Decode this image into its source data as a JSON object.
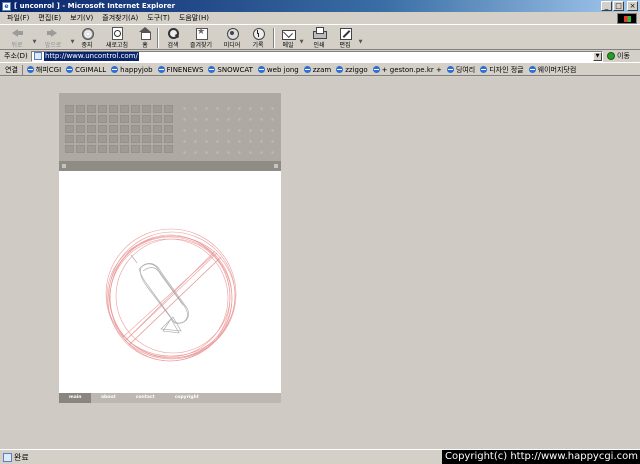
{
  "window": {
    "title": "[ unconrol ] - Microsoft Internet Explorer"
  },
  "menu": [
    "파일(F)",
    "편집(E)",
    "보기(V)",
    "즐겨찾기(A)",
    "도구(T)",
    "도움말(H)"
  ],
  "toolbar": {
    "back": "뒤로",
    "forward": "앞으로",
    "stop": "중지",
    "refresh": "새로고침",
    "home": "홈",
    "search": "검색",
    "favorites": "즐겨찾기",
    "media": "미디어",
    "history": "기록",
    "mail": "메일",
    "print": "인쇄",
    "edit": "편집"
  },
  "address": {
    "label": "주소(D)",
    "url": "http://www.uncontrol.com/",
    "go": "이동"
  },
  "links": {
    "label": "연결",
    "items": [
      "해피CGI",
      "CGIMALL",
      "happyjob",
      "FINENEWS",
      "SNOWCAT",
      "web jong",
      "zzam",
      "zziggo",
      "+ geston.pe.kr +",
      "딩여리",
      "디자인 정글",
      "웨이머지닷컴"
    ]
  },
  "site": {
    "nav": [
      "main",
      "about",
      "contact",
      "copyright"
    ],
    "colors": {
      "header": "#aeaaa3",
      "strip": "#8f8b85",
      "nav": "#bcb7b0",
      "nav_active": "#8a867f",
      "sketch": "#e88a8a"
    }
  },
  "status": {
    "text": "완료"
  },
  "copyright": "Copyright(c) http://www.happycgi.com"
}
